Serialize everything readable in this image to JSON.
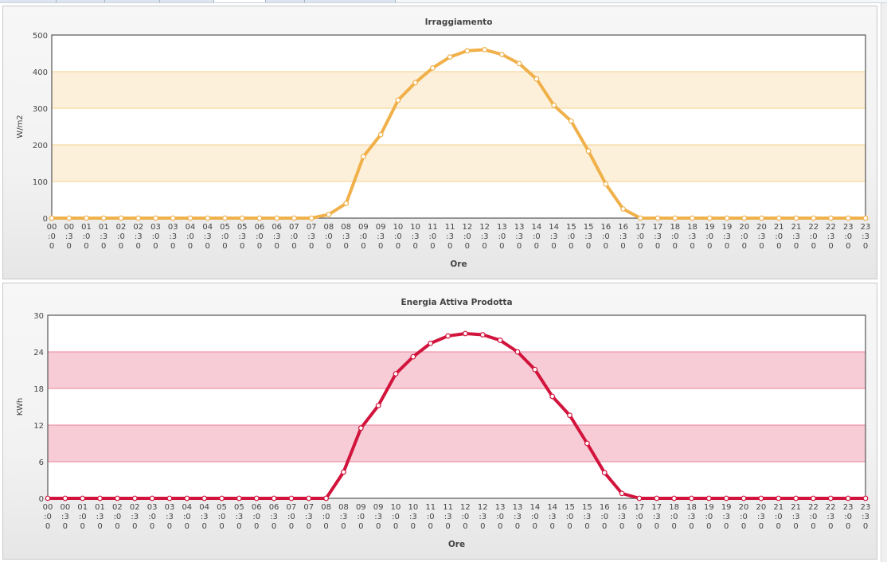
{
  "chart_data": [
    {
      "type": "line",
      "title": "Irraggiamento",
      "xlabel": "Ore",
      "ylabel": "W/m2",
      "ylim": [
        0,
        500
      ],
      "yticks": [
        "0",
        "100",
        "200",
        "300",
        "400",
        "500"
      ],
      "x": [
        "00:00",
        "00:30",
        "01:00",
        "01:30",
        "02:00",
        "02:30",
        "03:00",
        "03:30",
        "04:00",
        "04:30",
        "05:00",
        "05:30",
        "06:00",
        "06:30",
        "07:00",
        "07:30",
        "08:00",
        "08:30",
        "09:00",
        "09:30",
        "10:00",
        "10:30",
        "11:00",
        "11:30",
        "12:00",
        "12:30",
        "13:00",
        "13:30",
        "14:00",
        "14:30",
        "15:00",
        "15:30",
        "16:00",
        "16:30",
        "17:00",
        "17:30",
        "18:00",
        "18:30",
        "19:00",
        "19:30",
        "20:00",
        "20:30",
        "21:00",
        "21:30",
        "22:00",
        "22:30",
        "23:00",
        "23:30"
      ],
      "series": [
        {
          "values": [
            0,
            0,
            0,
            0,
            0,
            0,
            0,
            0,
            0,
            0,
            0,
            0,
            0,
            0,
            0,
            0,
            10,
            40,
            168,
            228,
            322,
            370,
            410,
            440,
            457,
            460,
            447,
            422,
            380,
            308,
            265,
            183,
            93,
            25,
            0,
            0,
            0,
            0,
            0,
            0,
            0,
            0,
            0,
            0,
            0,
            0,
            0,
            0
          ],
          "color": "#f0b04a"
        }
      ],
      "band_color": "#fdf0da",
      "band_line_color": "#f3d28e",
      "grid": "alternating horizontal bands",
      "legend": "none"
    },
    {
      "type": "line",
      "title": "Energia Attiva Prodotta",
      "xlabel": "Ore",
      "ylabel": "KWh",
      "ylim": [
        0,
        30
      ],
      "yticks": [
        "0",
        "6",
        "12",
        "18",
        "24",
        "30"
      ],
      "x": [
        "00:00",
        "00:30",
        "01:00",
        "01:30",
        "02:00",
        "02:30",
        "03:00",
        "03:30",
        "04:00",
        "04:30",
        "05:00",
        "05:30",
        "06:00",
        "06:30",
        "07:00",
        "07:30",
        "08:00",
        "08:30",
        "09:00",
        "09:30",
        "10:00",
        "10:30",
        "11:00",
        "11:30",
        "12:00",
        "12:30",
        "13:00",
        "13:30",
        "14:00",
        "14:30",
        "15:00",
        "15:30",
        "16:00",
        "16:30",
        "17:00",
        "17:30",
        "18:00",
        "18:30",
        "19:00",
        "19:30",
        "20:00",
        "20:30",
        "21:00",
        "21:30",
        "22:00",
        "22:30",
        "23:00",
        "23:30"
      ],
      "series": [
        {
          "values": [
            0,
            0,
            0,
            0,
            0,
            0,
            0,
            0,
            0,
            0,
            0,
            0,
            0,
            0,
            0,
            0,
            0,
            4.3,
            11.5,
            15.2,
            20.4,
            23.2,
            25.4,
            26.6,
            27.0,
            26.8,
            25.9,
            24.0,
            21.1,
            16.7,
            13.6,
            9.0,
            4.2,
            0.8,
            0,
            0,
            0,
            0,
            0,
            0,
            0,
            0,
            0,
            0,
            0,
            0,
            0,
            0
          ],
          "color": "#d2143c"
        }
      ],
      "band_color": "#f7ccd6",
      "band_line_color": "#e8839a",
      "grid": "alternating horizontal bands",
      "legend": "none"
    }
  ]
}
